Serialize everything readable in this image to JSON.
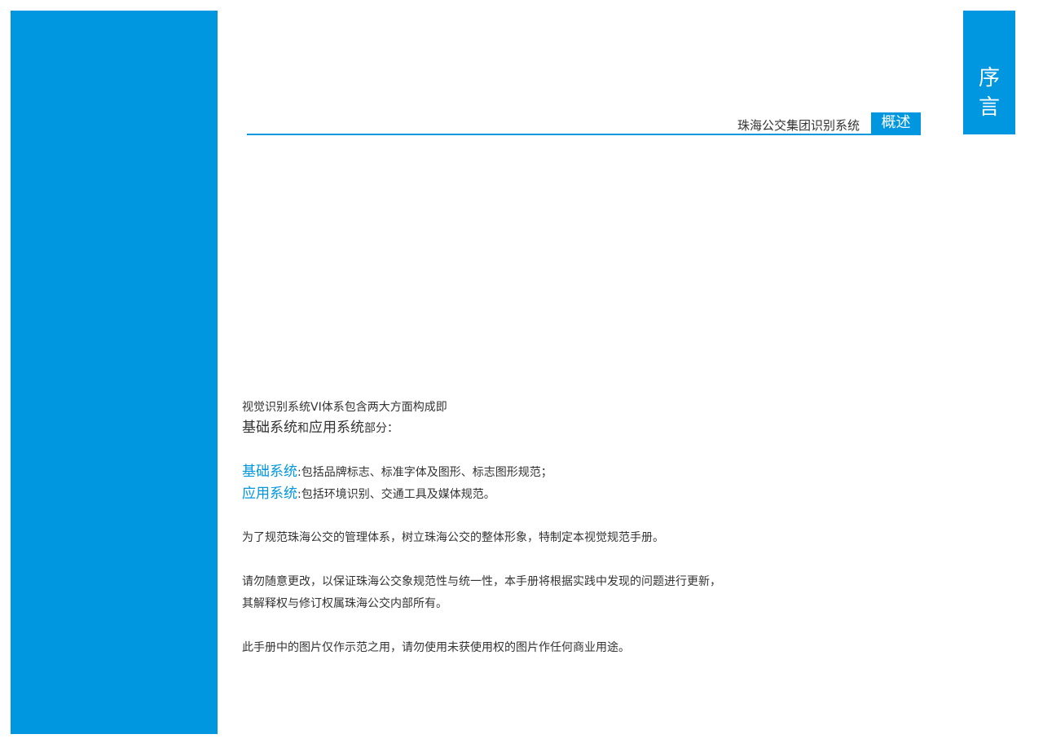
{
  "colors": {
    "accent": "#0097e0",
    "text": "#333333",
    "background": "#ffffff"
  },
  "header": {
    "title": "珠海公交集团识别系统",
    "badge": "概述"
  },
  "section_tab": {
    "chars": [
      "序",
      "言"
    ]
  },
  "intro": {
    "line1": "视觉识别系统VI体系包含两大方面构成即",
    "part_a": "基础系统",
    "connector": "和",
    "part_b": "应用系统",
    "suffix": "部分："
  },
  "systems": [
    {
      "name": "基础系统",
      "desc": ":包括品牌标志、标准字体及图形、标志图形规范；"
    },
    {
      "name": "应用系统",
      "desc": ":包括环境识别、交通工具及媒体规范。"
    }
  ],
  "paragraphs": {
    "purpose": "为了规范珠海公交的管理体系，树立珠海公交的整体形象，特制定本视觉规范手册。",
    "notice_line1": "请勿随意更改，以保证珠海公交象规范性与统一性，本手册将根据实践中发现的问题进行更新，",
    "notice_line2": "其解释权与修订权属珠海公交内部所有。",
    "image_notice": "此手册中的图片仅作示范之用，请勿使用未获使用权的图片作任何商业用途。"
  }
}
